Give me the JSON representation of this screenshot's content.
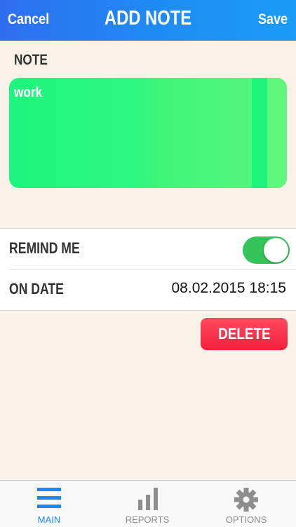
{
  "navbar": {
    "cancel_label": "Cancel",
    "title": "ADD NOTE",
    "save_label": "Save"
  },
  "note": {
    "label": "NOTE",
    "text": "work",
    "color": "#2ef781"
  },
  "settings": {
    "remind_label": "REMIND ME",
    "remind_enabled": true,
    "date_label": "ON DATE",
    "date_value": "08.02.2015 18:15"
  },
  "delete_label": "DELETE",
  "tabs": [
    {
      "label": "MAIN",
      "icon": "menu-icon",
      "active": true
    },
    {
      "label": "REPORTS",
      "icon": "bar-chart-icon",
      "active": false
    },
    {
      "label": "OPTIONS",
      "icon": "gear-icon",
      "active": false
    }
  ],
  "colors": {
    "accent": "#1b86f4",
    "toggle_on": "#35c45a",
    "delete": "#f41f3d",
    "background": "#faf1e8"
  }
}
